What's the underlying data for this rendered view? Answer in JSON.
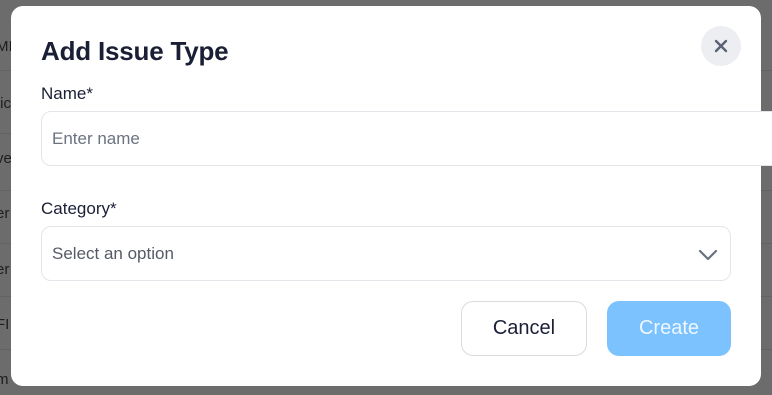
{
  "background": {
    "fragments": [
      "MI",
      "tic",
      "ve",
      "er",
      "er",
      "FI",
      "m"
    ]
  },
  "modal": {
    "title": "Add Issue Type",
    "close_icon": "close-icon",
    "name_field": {
      "label": "Name*",
      "placeholder": "Enter name",
      "value": ""
    },
    "category_field": {
      "label": "Category*",
      "selected": "Select an option",
      "icon": "chevron-down-icon"
    },
    "buttons": {
      "cancel": "Cancel",
      "create": "Create"
    }
  },
  "colors": {
    "title": "#1a1f36",
    "create_button_bg": "#7cc2ff",
    "close_button_bg": "#eceef2",
    "input_border": "#e3e5ea"
  }
}
